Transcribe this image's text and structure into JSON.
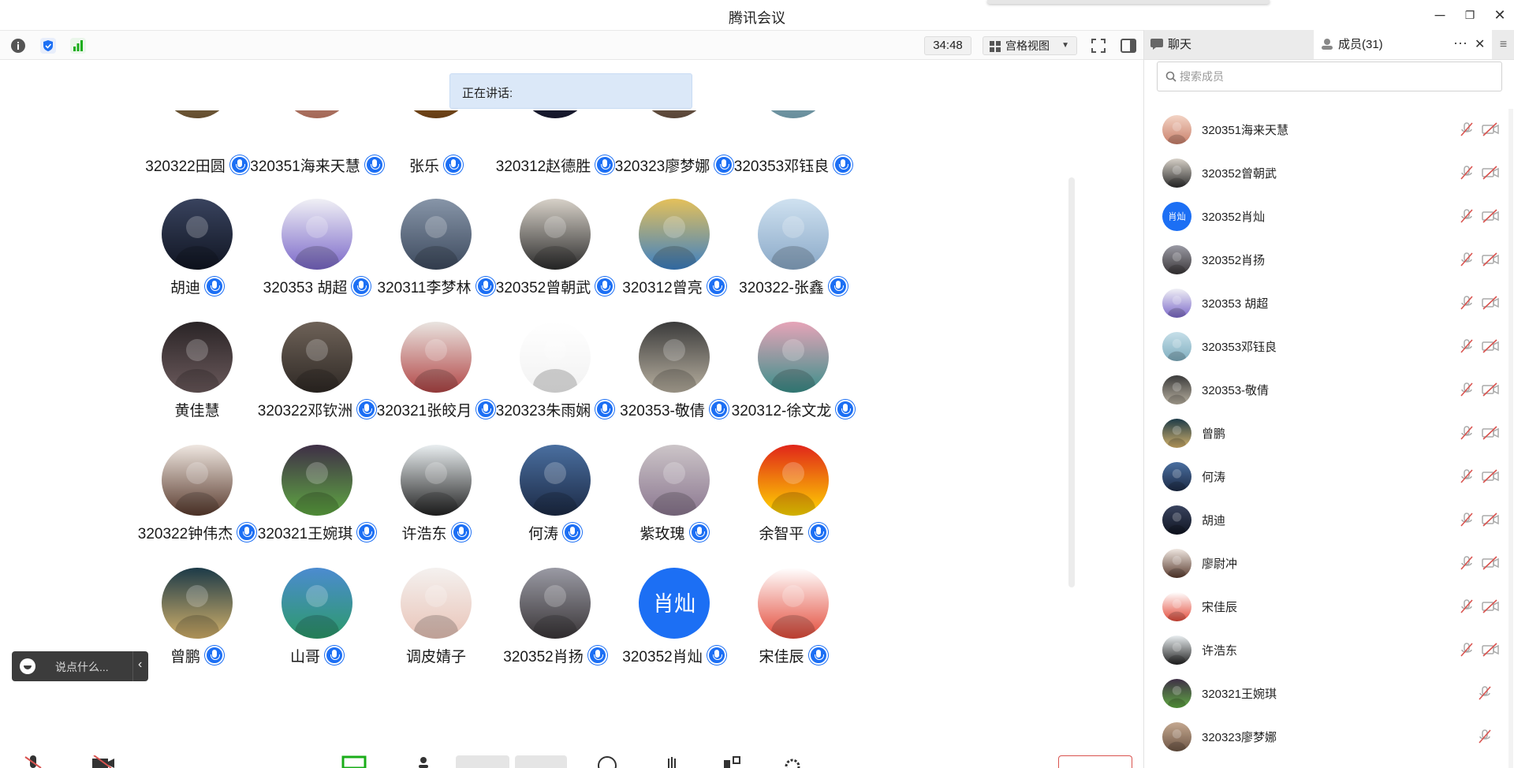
{
  "window": {
    "title": "腾讯会议",
    "minimize": "─",
    "restore": "❐",
    "close": "✕"
  },
  "toolbar": {
    "timer": "34:48",
    "view_label": "宫格视图"
  },
  "speaking": {
    "label": "正在讲话:"
  },
  "grid": {
    "rows": [
      [
        {
          "name": "320322田圆",
          "mic": true
        },
        {
          "name": "320351海来天慧",
          "mic": true
        },
        {
          "name": "张乐",
          "mic": true
        },
        {
          "name": "320312赵德胜",
          "mic": true
        },
        {
          "name": "320323廖梦娜",
          "mic": true
        },
        {
          "name": "320353邓钰良",
          "mic": true
        }
      ],
      [
        {
          "name": "胡迪",
          "mic": true
        },
        {
          "name": "320353  胡超",
          "mic": true
        },
        {
          "name": "320311李梦林",
          "mic": true
        },
        {
          "name": "320352曾朝武",
          "mic": true
        },
        {
          "name": "320312曾亮",
          "mic": true
        },
        {
          "name": "320322-张鑫",
          "mic": true
        }
      ],
      [
        {
          "name": "黄佳慧",
          "mic": false
        },
        {
          "name": "320322邓钦洲",
          "mic": true
        },
        {
          "name": "320321张皎月",
          "mic": true
        },
        {
          "name": "320323朱雨娴",
          "mic": true
        },
        {
          "name": "320353-敬倩",
          "mic": true
        },
        {
          "name": "320312-徐文龙",
          "mic": true
        }
      ],
      [
        {
          "name": "320322钟伟杰",
          "mic": true
        },
        {
          "name": "320321王婉琪",
          "mic": true
        },
        {
          "name": "许浩东",
          "mic": true
        },
        {
          "name": "何涛",
          "mic": true
        },
        {
          "name": "紫玫瑰",
          "mic": true
        },
        {
          "name": "余智平",
          "mic": true
        }
      ],
      [
        {
          "name": "曾鹏",
          "mic": true
        },
        {
          "name": "山哥",
          "mic": true
        },
        {
          "name": "调皮婧子",
          "mic": false
        },
        {
          "name": "320352肖扬",
          "mic": true
        },
        {
          "name": "320352肖灿",
          "mic": true,
          "avatar_text": "肖灿"
        },
        {
          "name": "宋佳辰",
          "mic": true
        }
      ]
    ]
  },
  "chat_input": {
    "placeholder": "说点什么..."
  },
  "panel": {
    "tab_chat": "聊天",
    "tab_members": "成员(31)",
    "more": "···",
    "close": "✕",
    "menu": "≡",
    "search_placeholder": "搜索成员",
    "members": [
      {
        "name": "320351海来天慧",
        "cam": true
      },
      {
        "name": "320352曾朝武",
        "cam": true
      },
      {
        "name": "320352肖灿",
        "cam": true,
        "avatar_text": "肖灿"
      },
      {
        "name": "320352肖扬",
        "cam": true
      },
      {
        "name": "320353  胡超",
        "cam": true
      },
      {
        "name": "320353邓钰良",
        "cam": true
      },
      {
        "name": "320353-敬倩",
        "cam": true
      },
      {
        "name": "曾鹏",
        "cam": true
      },
      {
        "name": "何涛",
        "cam": true
      },
      {
        "name": "胡迪",
        "cam": true
      },
      {
        "name": "廖尉冲",
        "cam": true
      },
      {
        "name": "宋佳辰",
        "cam": true
      },
      {
        "name": "许浩东",
        "cam": true
      },
      {
        "name": "320321王婉琪",
        "cam": false
      },
      {
        "name": "320323廖梦娜",
        "cam": false
      }
    ]
  },
  "colors": {
    "accent": "#1c6ff4",
    "speaking_bg": "#dbe8f8",
    "muted_red": "#d9534f"
  }
}
